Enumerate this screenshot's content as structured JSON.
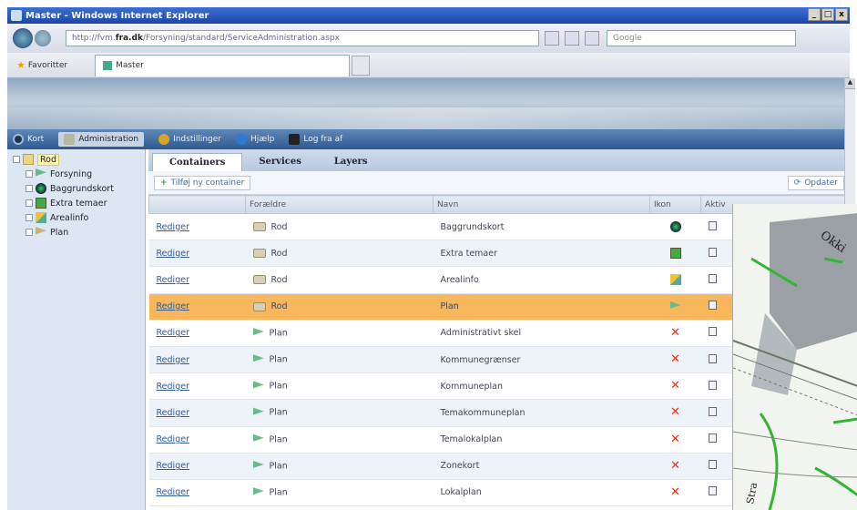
{
  "browser": {
    "title": "Master - Windows Internet Explorer",
    "address_prefix": "http://fvm.",
    "address_bold": "fra.dk",
    "address_suffix": "/Forsyning/standard/ServiceAdministration.aspx",
    "search_placeholder": "Google",
    "favorites_label": "Favoritter",
    "tab_title": "Master",
    "window_buttons": [
      "_",
      "□",
      "x"
    ]
  },
  "menu": {
    "items": [
      {
        "label": "Kort",
        "icon": "home-icon"
      },
      {
        "label": "Administration",
        "icon": "admin-icon"
      },
      {
        "label": "Indstillinger",
        "icon": "gear-icon"
      },
      {
        "label": "Hjælp",
        "icon": "help-icon"
      },
      {
        "label": "Log fra af",
        "icon": "logout-icon"
      }
    ]
  },
  "tree": {
    "root": "Rod",
    "children": [
      {
        "label": "Forsyning",
        "icon": "flag-icon"
      },
      {
        "label": "Baggrundskort",
        "icon": "globe-icon"
      },
      {
        "label": "Extra temaer",
        "icon": "layers-icon"
      },
      {
        "label": "Arealinfo",
        "icon": "area-icon"
      },
      {
        "label": "Plan",
        "icon": "plan-icon"
      }
    ]
  },
  "tabs": [
    "Containers",
    "Services",
    "Layers"
  ],
  "toolbar": {
    "add_label": "Tilføj ny container",
    "refresh_label": "Opdater"
  },
  "grid": {
    "columns": [
      "",
      "Forældre",
      "Navn",
      "Ikon",
      "Aktiv"
    ],
    "rows": [
      {
        "action": "Rediger",
        "parent": "Rod",
        "name": "Baggrundskort",
        "icon": "globe"
      },
      {
        "action": "Rediger",
        "parent": "Rod",
        "name": "Extra temaer",
        "icon": "layers"
      },
      {
        "action": "Rediger",
        "parent": "Rod",
        "name": "Arealinfo",
        "icon": "area"
      },
      {
        "action": "Rediger",
        "parent": "Rod",
        "name": "Plan",
        "icon": "flag",
        "selected": true
      },
      {
        "action": "Rediger",
        "parent": "Plan",
        "name": "Administrativt skel",
        "icon": "x"
      },
      {
        "action": "Rediger",
        "parent": "Plan",
        "name": "Kommunegrænser",
        "icon": "x"
      },
      {
        "action": "Rediger",
        "parent": "Plan",
        "name": "Kommuneplan",
        "icon": "x"
      },
      {
        "action": "Rediger",
        "parent": "Plan",
        "name": "Temakommuneplan",
        "icon": "x"
      },
      {
        "action": "Rediger",
        "parent": "Plan",
        "name": "Temalokalplan",
        "icon": "x"
      },
      {
        "action": "Rediger",
        "parent": "Plan",
        "name": "Zonekort",
        "icon": "x"
      },
      {
        "action": "Rediger",
        "parent": "Plan",
        "name": "Lokalplan",
        "icon": "x"
      }
    ]
  },
  "map_labels": [
    "Okki",
    "Stra"
  ],
  "colors": {
    "selected_row": "#f7b75a",
    "menubar": "#2f5a90",
    "delete": "#e3331a"
  }
}
